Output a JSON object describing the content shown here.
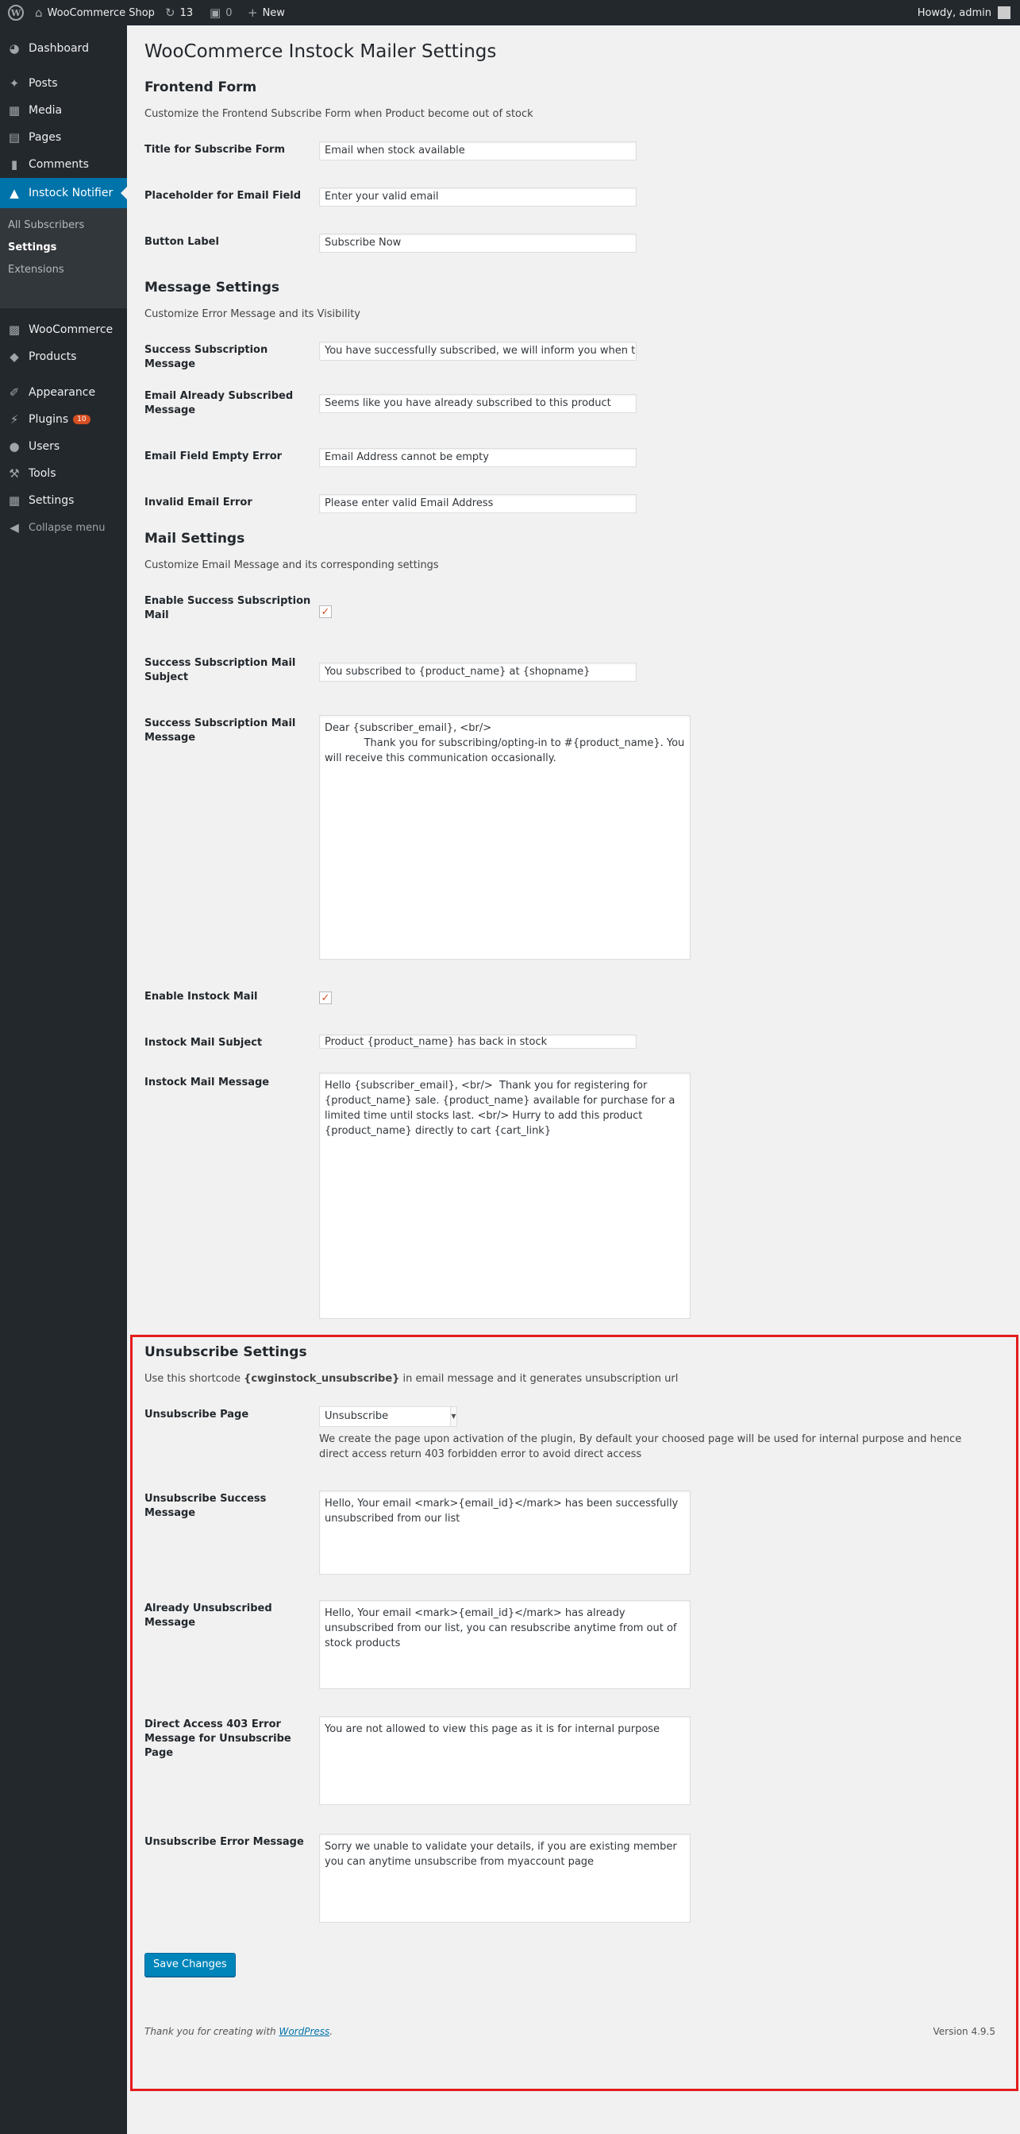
{
  "adminbar": {
    "site_name": "WooCommerce Shop",
    "updates_count": "13",
    "comments_count": "0",
    "new_label": "New",
    "howdy": "Howdy, admin"
  },
  "sidebar": {
    "items": [
      {
        "label": "Dashboard",
        "icon": "dashboard-icon"
      },
      {
        "label": "Posts",
        "icon": "pin-icon"
      },
      {
        "label": "Media",
        "icon": "media-icon"
      },
      {
        "label": "Pages",
        "icon": "pages-icon"
      },
      {
        "label": "Comments",
        "icon": "comment-icon"
      },
      {
        "label": "Instock Notifier",
        "icon": "bank-icon"
      },
      {
        "label": "WooCommerce",
        "icon": "woo-icon"
      },
      {
        "label": "Products",
        "icon": "archive-icon"
      },
      {
        "label": "Appearance",
        "icon": "brush-icon"
      },
      {
        "label": "Plugins",
        "icon": "plugin-icon",
        "badge": "10"
      },
      {
        "label": "Users",
        "icon": "users-icon"
      },
      {
        "label": "Tools",
        "icon": "wrench-icon"
      },
      {
        "label": "Settings",
        "icon": "settings-icon"
      },
      {
        "label": "Collapse menu",
        "icon": "collapse-icon"
      }
    ],
    "submenu": [
      "All Subscribers",
      "Settings",
      "Extensions"
    ]
  },
  "page": {
    "title": "WooCommerce Instock Mailer Settings",
    "frontend": {
      "heading": "Frontend Form",
      "desc": "Customize the Frontend Subscribe Form when Product become out of stock",
      "title_label": "Title for Subscribe Form",
      "title_value": "Email when stock available",
      "placeholder_label": "Placeholder for Email Field",
      "placeholder_value": "Enter your valid email",
      "button_label_label": "Button Label",
      "button_label_value": "Subscribe Now"
    },
    "message": {
      "heading": "Message Settings",
      "desc": "Customize Error Message and its Visibility",
      "success_label": "Success Subscription Message",
      "success_value": "You have successfully subscribed, we will inform you when this product back in stock",
      "already_label": "Email Already Subscribed Message",
      "already_value": "Seems like you have already subscribed to this product",
      "empty_label": "Email Field Empty Error",
      "empty_value": "Email Address cannot be empty",
      "invalid_label": "Invalid Email Error",
      "invalid_value": "Please enter valid Email Address"
    },
    "mail": {
      "heading": "Mail Settings",
      "desc": "Customize Email Message and its corresponding settings",
      "enable_success_label": "Enable Success Subscription Mail",
      "success_subject_label": "Success Subscription Mail Subject",
      "success_subject_value": "You subscribed to {product_name} at {shopname}",
      "success_message_label": "Success Subscription Mail Message",
      "success_message_value": "Dear {subscriber_email}, <br/>\n            Thank you for subscribing/opting-in to #{product_name}. You will receive this communication occasionally.",
      "enable_instock_label": "Enable Instock Mail",
      "instock_subject_label": "Instock Mail Subject",
      "instock_subject_value": "Product {product_name} has back in stock",
      "instock_message_label": "Instock Mail Message",
      "instock_message_value": "Hello {subscriber_email}, <br/>  Thank you for registering for {product_name} sale. {product_name} available for purchase for a limited time until stocks last. <br/> Hurry to add this product {product_name} directly to cart {cart_link}"
    },
    "unsubscribe": {
      "heading": "Unsubscribe Settings",
      "desc_pre": "Use this shortcode ",
      "desc_code": "{cwginstock_unsubscribe}",
      "desc_post": " in email message and it generates unsubscription url",
      "page_label": "Unsubscribe Page",
      "page_value": "Unsubscribe",
      "page_desc": "We create the page upon activation of the plugin, By default your choosed page will be used for internal purpose and hence direct access return 403 forbidden error to avoid direct access",
      "success_label": "Unsubscribe Success Message",
      "success_value": "Hello, Your email <mark>{email_id}</mark> has been successfully unsubscribed from our list",
      "already_label": "Already Unsubscribed Message",
      "already_value": "Hello, Your email <mark>{email_id}</mark> has already unsubscribed from our list, you can resubscribe anytime from out of stock products",
      "direct_label": "Direct Access 403 Error Message for Unsubscribe Page",
      "direct_value": "You are not allowed to view this page as it is for internal purpose",
      "error_label": "Unsubscribe Error Message",
      "error_value": "Sorry we unable to validate your details, if you are existing member you can anytime unsubscribe from myaccount page"
    },
    "save_label": "Save Changes",
    "footer_pre": "Thank you for creating with ",
    "footer_link": "WordPress",
    "footer_post": ".",
    "version": "Version 4.9.5"
  },
  "colors": {
    "accent": "#0073aa",
    "highlight": "#e51b1b",
    "sidebar_bg": "#23282d",
    "checkbox_check": "#d54e21"
  }
}
